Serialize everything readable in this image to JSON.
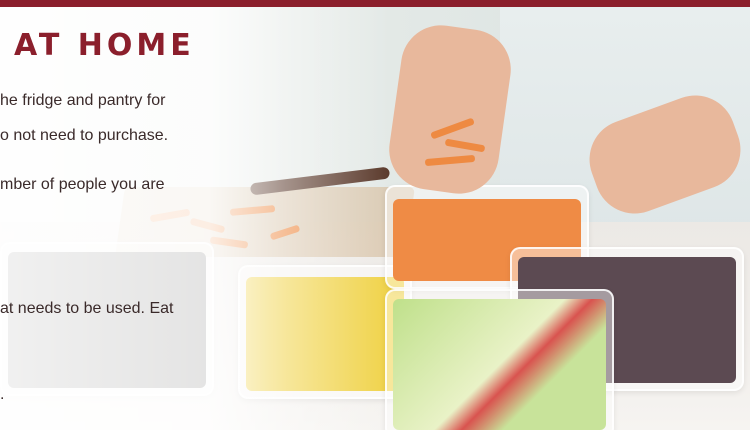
{
  "heading": "AT HOME",
  "lines": [
    "he fridge and pantry for",
    "o not need to purchase.",
    "mber of people you are",
    "at needs to be used. Eat",
    "."
  ],
  "colors": {
    "accent": "#8b1f2c",
    "text": "#3a2a2a"
  },
  "photo": "hands-dropping-carrot-sticks-into-containers-of-prepped-vegetables"
}
